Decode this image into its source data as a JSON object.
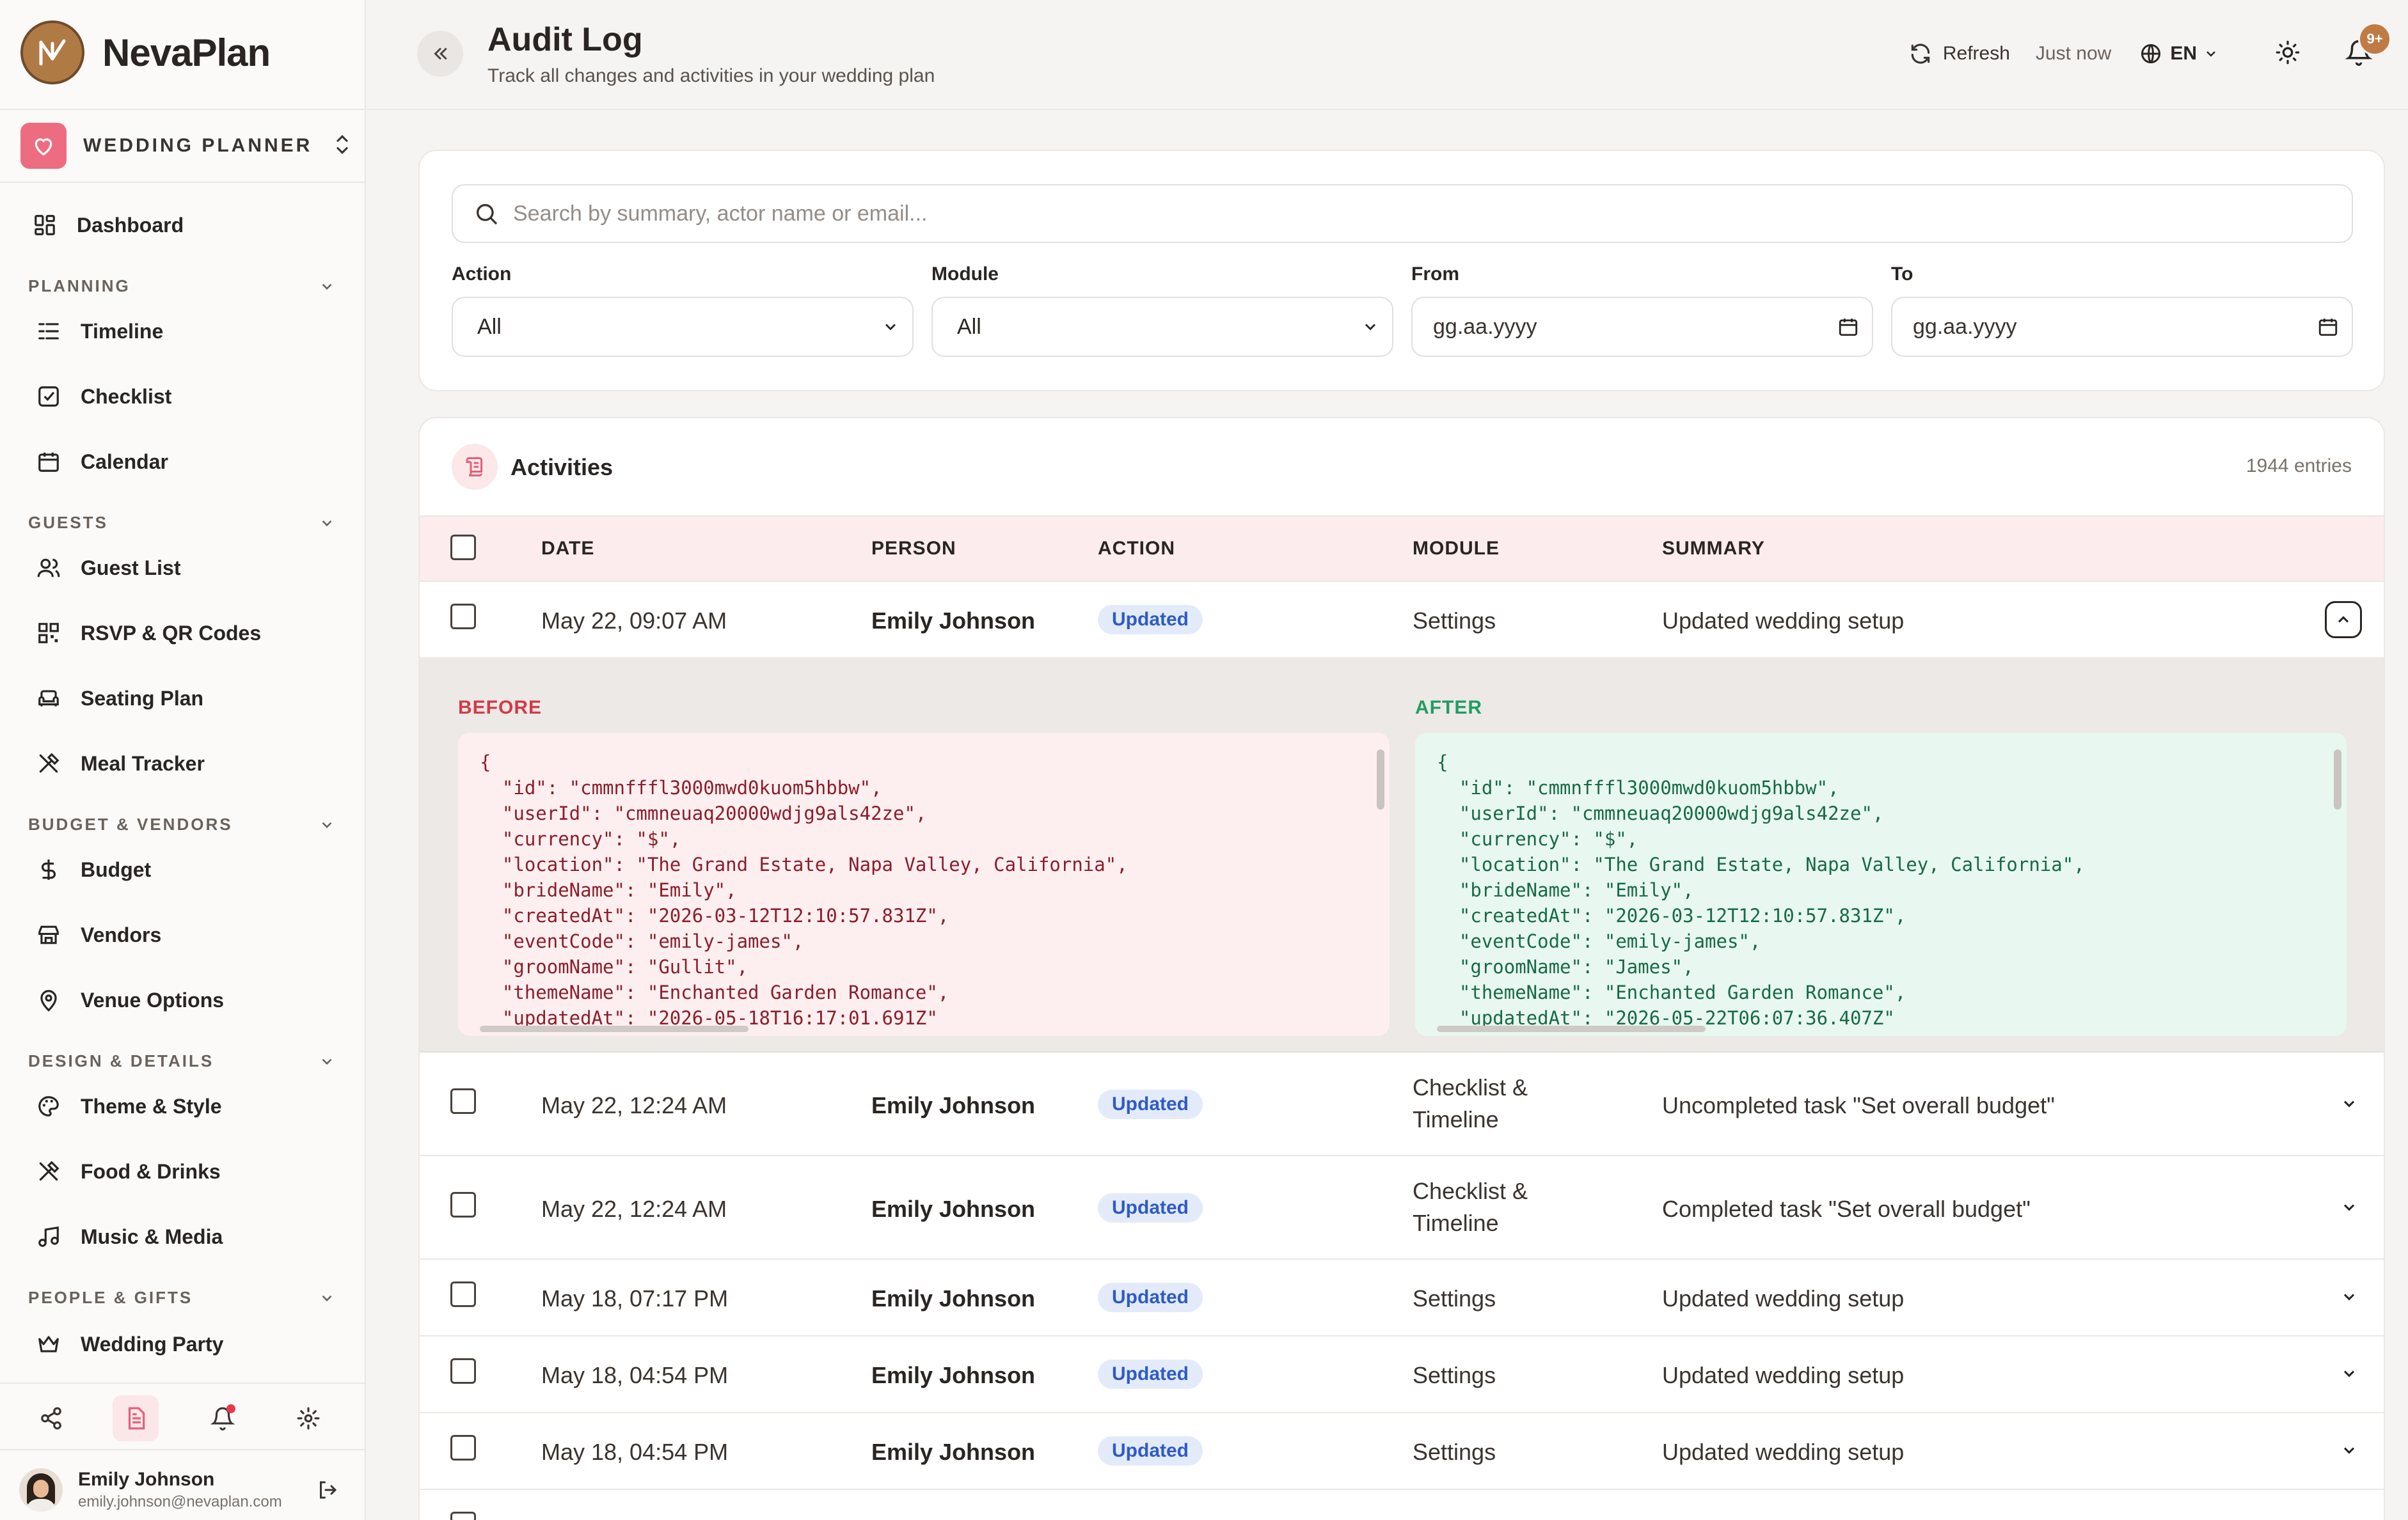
{
  "brand": {
    "name": "NevaPlan"
  },
  "workspace": {
    "name": "WEDDING PLANNER"
  },
  "nav": {
    "dashboard": "Dashboard",
    "sections": [
      {
        "title": "PLANNING",
        "items": [
          "Timeline",
          "Checklist",
          "Calendar"
        ]
      },
      {
        "title": "GUESTS",
        "items": [
          "Guest List",
          "RSVP & QR Codes",
          "Seating Plan",
          "Meal Tracker"
        ]
      },
      {
        "title": "BUDGET & VENDORS",
        "items": [
          "Budget",
          "Vendors",
          "Venue Options"
        ]
      },
      {
        "title": "DESIGN & DETAILS",
        "items": [
          "Theme & Style",
          "Food & Drinks",
          "Music & Media"
        ]
      },
      {
        "title": "PEOPLE & GIFTS",
        "items": [
          "Wedding Party"
        ]
      }
    ]
  },
  "user": {
    "name": "Emily Johnson",
    "email": "emily.johnson@nevaplan.com"
  },
  "header": {
    "title": "Audit Log",
    "subtitle": "Track all changes and activities in your wedding plan",
    "refresh": "Refresh",
    "last_updated": "Just now",
    "language": "EN",
    "notification_count": "9+"
  },
  "filters": {
    "search_placeholder": "Search by summary, actor name or email...",
    "action_label": "Action",
    "action_value": "All",
    "module_label": "Module",
    "module_value": "All",
    "from_label": "From",
    "from_value": "gg.aa.yyyy",
    "to_label": "To",
    "to_value": "gg.aa.yyyy"
  },
  "activities": {
    "title": "Activities",
    "count": "1944 entries",
    "columns": {
      "date": "DATE",
      "person": "PERSON",
      "action": "ACTION",
      "module": "MODULE",
      "summary": "SUMMARY"
    },
    "rows": [
      {
        "date": "May 22, 09:07 AM",
        "person": "Emily Johnson",
        "action": "Updated",
        "module": "Settings",
        "summary": "Updated wedding setup",
        "expanded": true
      },
      {
        "date": "May 22, 12:24 AM",
        "person": "Emily Johnson",
        "action": "Updated",
        "module": "Checklist & Timeline",
        "summary": "Uncompleted task \"Set overall budget\""
      },
      {
        "date": "May 22, 12:24 AM",
        "person": "Emily Johnson",
        "action": "Updated",
        "module": "Checklist & Timeline",
        "summary": "Completed task \"Set overall budget\""
      },
      {
        "date": "May 18, 07:17 PM",
        "person": "Emily Johnson",
        "action": "Updated",
        "module": "Settings",
        "summary": "Updated wedding setup"
      },
      {
        "date": "May 18, 04:54 PM",
        "person": "Emily Johnson",
        "action": "Updated",
        "module": "Settings",
        "summary": "Updated wedding setup"
      },
      {
        "date": "May 18, 04:54 PM",
        "person": "Emily Johnson",
        "action": "Updated",
        "module": "Settings",
        "summary": "Updated wedding setup"
      }
    ],
    "detail": {
      "before_label": "BEFORE",
      "after_label": "AFTER",
      "before_json": "{\n  \"id\": \"cmmnfffl3000mwd0kuom5hbbw\",\n  \"userId\": \"cmmneuaq20000wdjg9als42ze\",\n  \"currency\": \"$\",\n  \"location\": \"The Grand Estate, Napa Valley, California\",\n  \"brideName\": \"Emily\",\n  \"createdAt\": \"2026-03-12T12:10:57.831Z\",\n  \"eventCode\": \"emily-james\",\n  \"groomName\": \"Gullit\",\n  \"themeName\": \"Enchanted Garden Romance\",\n  \"updatedAt\": \"2026-05-18T16:17:01.691Z\"",
      "after_json": "{\n  \"id\": \"cmmnfffl3000mwd0kuom5hbbw\",\n  \"userId\": \"cmmneuaq20000wdjg9als42ze\",\n  \"currency\": \"$\",\n  \"location\": \"The Grand Estate, Napa Valley, California\",\n  \"brideName\": \"Emily\",\n  \"createdAt\": \"2026-03-12T12:10:57.831Z\",\n  \"eventCode\": \"emily-james\",\n  \"groomName\": \"James\",\n  \"themeName\": \"Enchanted Garden Romance\",\n  \"updatedAt\": \"2026-05-22T06:07:36.407Z\""
    }
  },
  "colors": {
    "accent": "#b07a45",
    "brand_pink": "#ee6c80",
    "badge_blue": "#2f5bc4",
    "before_red": "#d23a48",
    "after_green": "#1f9d62"
  }
}
